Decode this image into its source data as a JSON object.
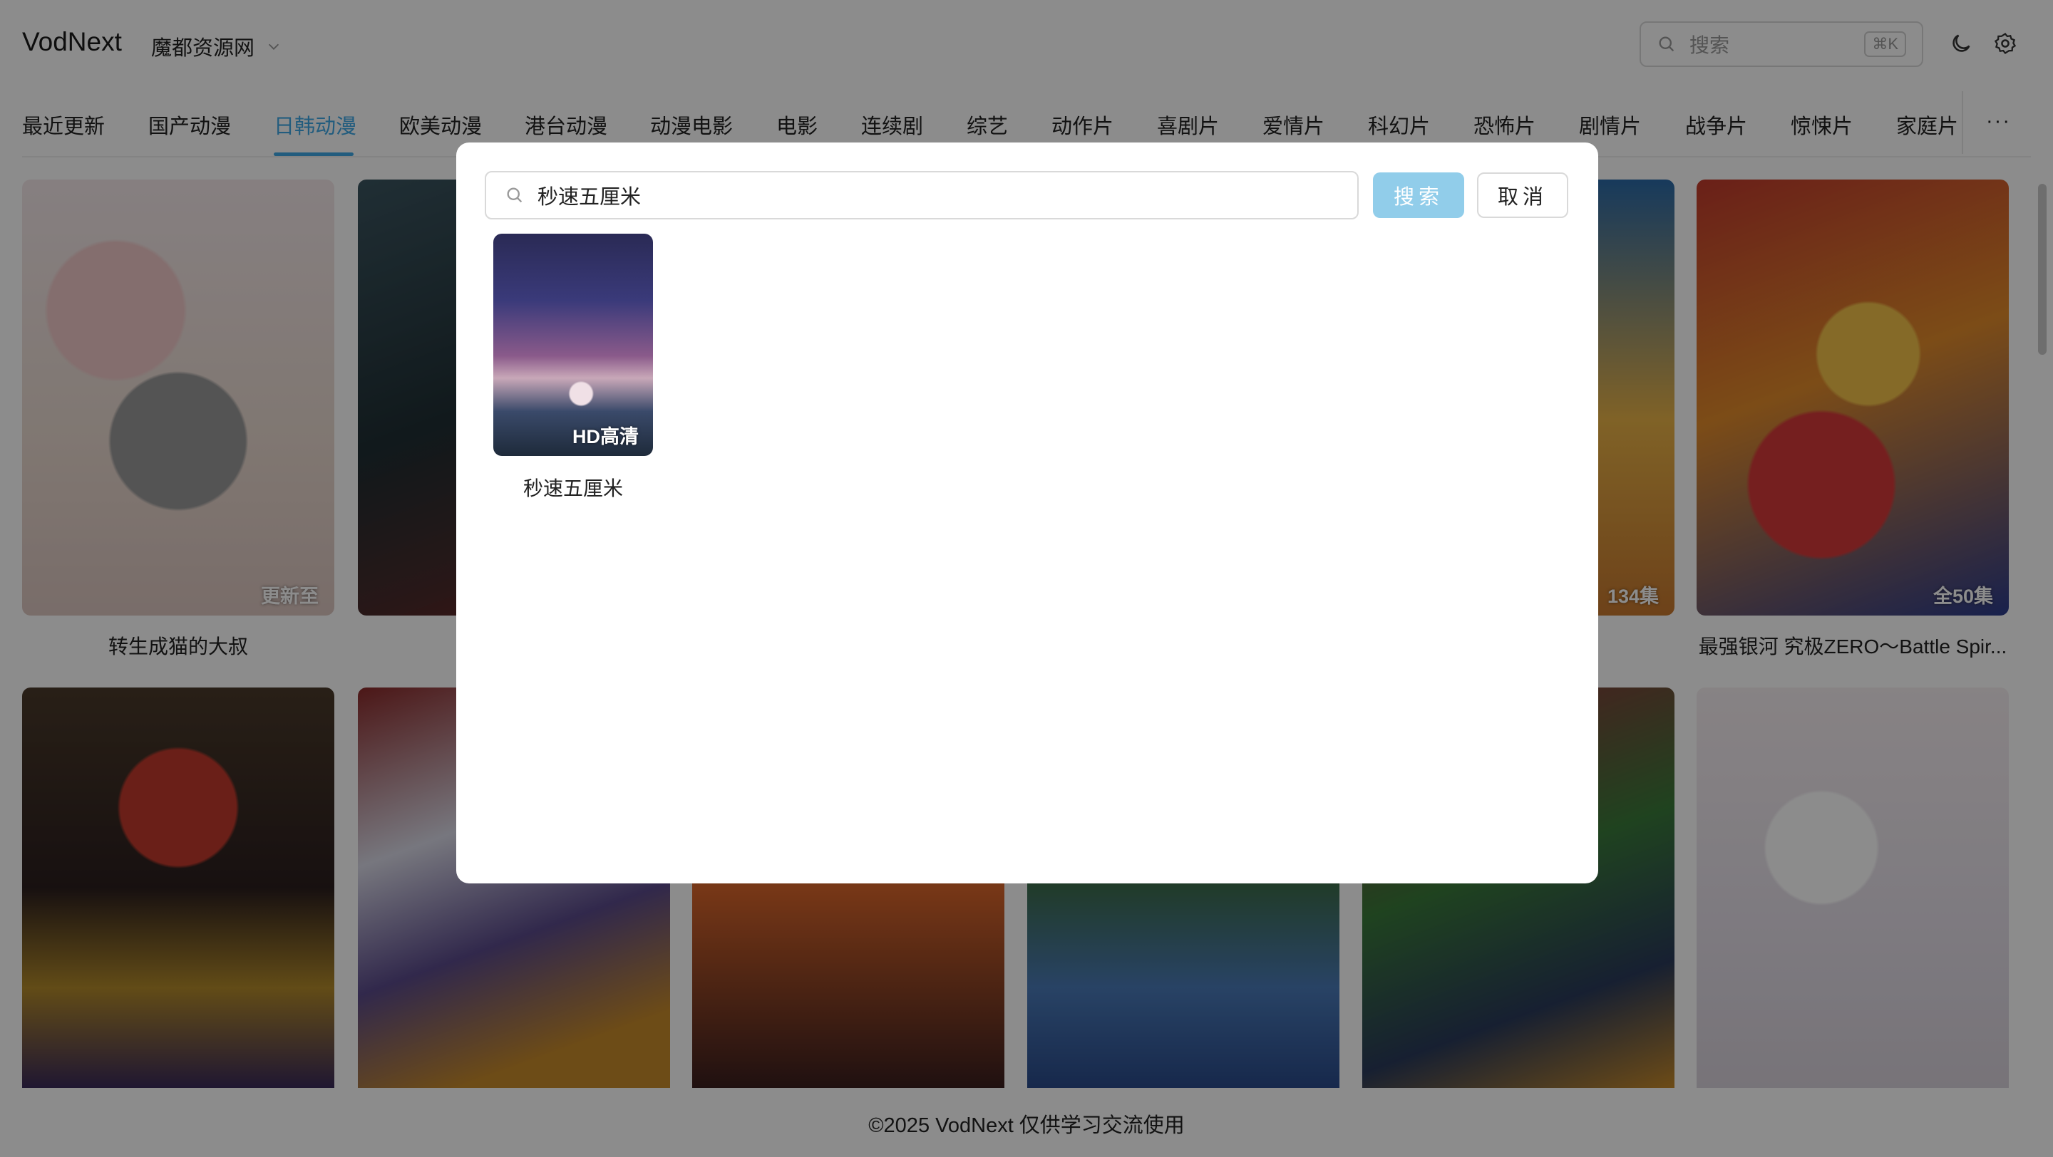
{
  "header": {
    "logo": "VodNext",
    "source_select": "魔都资源网",
    "search_placeholder": "搜索",
    "search_shortcut": "⌘K"
  },
  "tabs": [
    {
      "label": "最近更新"
    },
    {
      "label": "国产动漫"
    },
    {
      "label": "日韩动漫",
      "active": true
    },
    {
      "label": "欧美动漫"
    },
    {
      "label": "港台动漫"
    },
    {
      "label": "动漫电影"
    },
    {
      "label": "电影"
    },
    {
      "label": "连续剧"
    },
    {
      "label": "综艺"
    },
    {
      "label": "动作片"
    },
    {
      "label": "喜剧片"
    },
    {
      "label": "爱情片"
    },
    {
      "label": "科幻片"
    },
    {
      "label": "恐怖片"
    },
    {
      "label": "剧情片"
    },
    {
      "label": "战争片"
    },
    {
      "label": "惊悚片"
    },
    {
      "label": "家庭片"
    }
  ],
  "tabs_more": "···",
  "grid": {
    "row1": [
      {
        "title": "转生成猫的大叔",
        "badge": "更新至"
      },
      {
        "title": "",
        "badge": ""
      },
      {
        "title": "",
        "badge": ""
      },
      {
        "title": "",
        "badge": ""
      },
      {
        "title": "",
        "badge": "134集"
      },
      {
        "title": "最强银河 究极ZERO～Battle Spir...",
        "badge": "全50集"
      }
    ],
    "row2_count": 6
  },
  "footer": "©2025 VodNext 仅供学习交流使用",
  "modal": {
    "query": "秒速五厘米",
    "search_button": "搜索",
    "cancel_button": "取消",
    "results": [
      {
        "title": "秒速五厘米",
        "badge": "HD高清"
      }
    ]
  },
  "colors": {
    "accent": "#3ea8e5",
    "search_button_bg": "#91cdea",
    "overlay": "rgba(0,0,0,0.45)"
  }
}
